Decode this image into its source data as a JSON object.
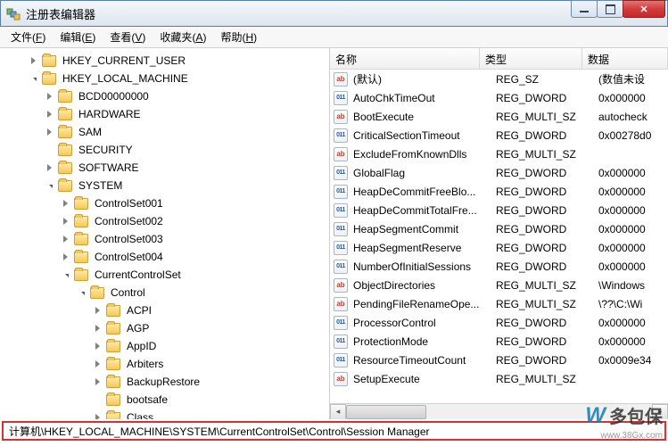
{
  "window": {
    "title": "注册表编辑器"
  },
  "menubar": {
    "file": "文件",
    "file_k": "F",
    "edit": "编辑",
    "edit_k": "E",
    "view": "查看",
    "view_k": "V",
    "favorites": "收藏夹",
    "favorites_k": "A",
    "help": "帮助",
    "help_k": "H"
  },
  "tree": [
    {
      "label": "HKEY_CURRENT_USER",
      "indent": 1,
      "exp": "closed",
      "icon": "folder"
    },
    {
      "label": "HKEY_LOCAL_MACHINE",
      "indent": 1,
      "exp": "open",
      "icon": "folder"
    },
    {
      "label": "BCD00000000",
      "indent": 2,
      "exp": "closed",
      "icon": "folder"
    },
    {
      "label": "HARDWARE",
      "indent": 2,
      "exp": "closed",
      "icon": "folder"
    },
    {
      "label": "SAM",
      "indent": 2,
      "exp": "closed",
      "icon": "folder"
    },
    {
      "label": "SECURITY",
      "indent": 2,
      "exp": "none",
      "icon": "folder"
    },
    {
      "label": "SOFTWARE",
      "indent": 2,
      "exp": "closed",
      "icon": "folder"
    },
    {
      "label": "SYSTEM",
      "indent": 2,
      "exp": "open",
      "icon": "folder"
    },
    {
      "label": "ControlSet001",
      "indent": 3,
      "exp": "closed",
      "icon": "folder"
    },
    {
      "label": "ControlSet002",
      "indent": 3,
      "exp": "closed",
      "icon": "folder"
    },
    {
      "label": "ControlSet003",
      "indent": 3,
      "exp": "closed",
      "icon": "folder"
    },
    {
      "label": "ControlSet004",
      "indent": 3,
      "exp": "closed",
      "icon": "folder"
    },
    {
      "label": "CurrentControlSet",
      "indent": 3,
      "exp": "open",
      "icon": "folder"
    },
    {
      "label": "Control",
      "indent": 4,
      "exp": "open",
      "icon": "folder"
    },
    {
      "label": "ACPI",
      "indent": 5,
      "exp": "closed",
      "icon": "folder"
    },
    {
      "label": "AGP",
      "indent": 5,
      "exp": "closed",
      "icon": "folder"
    },
    {
      "label": "AppID",
      "indent": 5,
      "exp": "closed",
      "icon": "folder"
    },
    {
      "label": "Arbiters",
      "indent": 5,
      "exp": "closed",
      "icon": "folder"
    },
    {
      "label": "BackupRestore",
      "indent": 5,
      "exp": "closed",
      "icon": "folder"
    },
    {
      "label": "bootsafe",
      "indent": 5,
      "exp": "none",
      "icon": "folder"
    },
    {
      "label": "Class",
      "indent": 5,
      "exp": "closed",
      "icon": "folder"
    }
  ],
  "list_header": {
    "name": "名称",
    "type": "类型",
    "data": "数据"
  },
  "values": [
    {
      "icon": "str",
      "name": "(默认)",
      "type": "REG_SZ",
      "data": "(数值未设"
    },
    {
      "icon": "bin",
      "name": "AutoChkTimeOut",
      "type": "REG_DWORD",
      "data": "0x000000"
    },
    {
      "icon": "str",
      "name": "BootExecute",
      "type": "REG_MULTI_SZ",
      "data": "autocheck"
    },
    {
      "icon": "bin",
      "name": "CriticalSectionTimeout",
      "type": "REG_DWORD",
      "data": "0x00278d0"
    },
    {
      "icon": "str",
      "name": "ExcludeFromKnownDlls",
      "type": "REG_MULTI_SZ",
      "data": ""
    },
    {
      "icon": "bin",
      "name": "GlobalFlag",
      "type": "REG_DWORD",
      "data": "0x000000"
    },
    {
      "icon": "bin",
      "name": "HeapDeCommitFreeBlo...",
      "type": "REG_DWORD",
      "data": "0x000000"
    },
    {
      "icon": "bin",
      "name": "HeapDeCommitTotalFre...",
      "type": "REG_DWORD",
      "data": "0x000000"
    },
    {
      "icon": "bin",
      "name": "HeapSegmentCommit",
      "type": "REG_DWORD",
      "data": "0x000000"
    },
    {
      "icon": "bin",
      "name": "HeapSegmentReserve",
      "type": "REG_DWORD",
      "data": "0x000000"
    },
    {
      "icon": "bin",
      "name": "NumberOfInitialSessions",
      "type": "REG_DWORD",
      "data": "0x000000"
    },
    {
      "icon": "str",
      "name": "ObjectDirectories",
      "type": "REG_MULTI_SZ",
      "data": "\\Windows"
    },
    {
      "icon": "str",
      "name": "PendingFileRenameOpe...",
      "type": "REG_MULTI_SZ",
      "data": "\\??\\C:\\Wi"
    },
    {
      "icon": "bin",
      "name": "ProcessorControl",
      "type": "REG_DWORD",
      "data": "0x000000"
    },
    {
      "icon": "bin",
      "name": "ProtectionMode",
      "type": "REG_DWORD",
      "data": "0x000000"
    },
    {
      "icon": "bin",
      "name": "ResourceTimeoutCount",
      "type": "REG_DWORD",
      "data": "0x0009e34"
    },
    {
      "icon": "str",
      "name": "SetupExecute",
      "type": "REG_MULTI_SZ",
      "data": ""
    }
  ],
  "statusbar": {
    "path": "计算机\\HKEY_LOCAL_MACHINE\\SYSTEM\\CurrentControlSet\\Control\\Session Manager"
  },
  "watermark": {
    "text": "多包保",
    "url": "www.38Gx.com"
  }
}
